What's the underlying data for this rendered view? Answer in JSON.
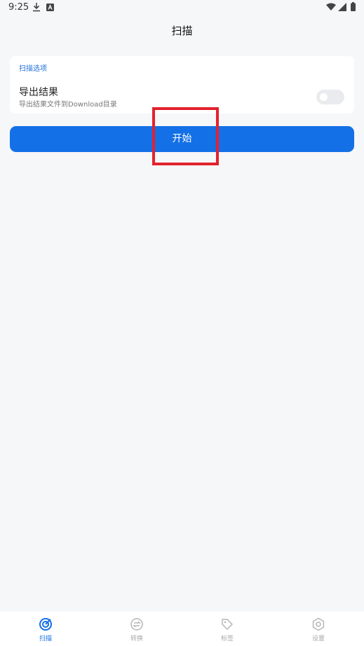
{
  "status_bar": {
    "time": "9:25",
    "icons": [
      "download-icon",
      "a-icon",
      "wifi-icon",
      "signal-icon",
      "battery-icon"
    ]
  },
  "header": {
    "title": "扫描"
  },
  "options_card": {
    "header": "扫描选项",
    "option_title": "导出结果",
    "option_desc": "导出结果文件到Download目录",
    "toggle_on": false
  },
  "start_button": {
    "label": "开始"
  },
  "bottom_nav": {
    "items": [
      {
        "label": "扫描",
        "icon": "scan-icon",
        "active": true
      },
      {
        "label": "转换",
        "icon": "convert-icon",
        "active": false
      },
      {
        "label": "标签",
        "icon": "tag-icon",
        "active": false
      },
      {
        "label": "设置",
        "icon": "settings-icon",
        "active": false
      }
    ]
  },
  "colors": {
    "accent": "#1370e6",
    "highlight": "#e3222d",
    "background": "#f6f7f9"
  }
}
